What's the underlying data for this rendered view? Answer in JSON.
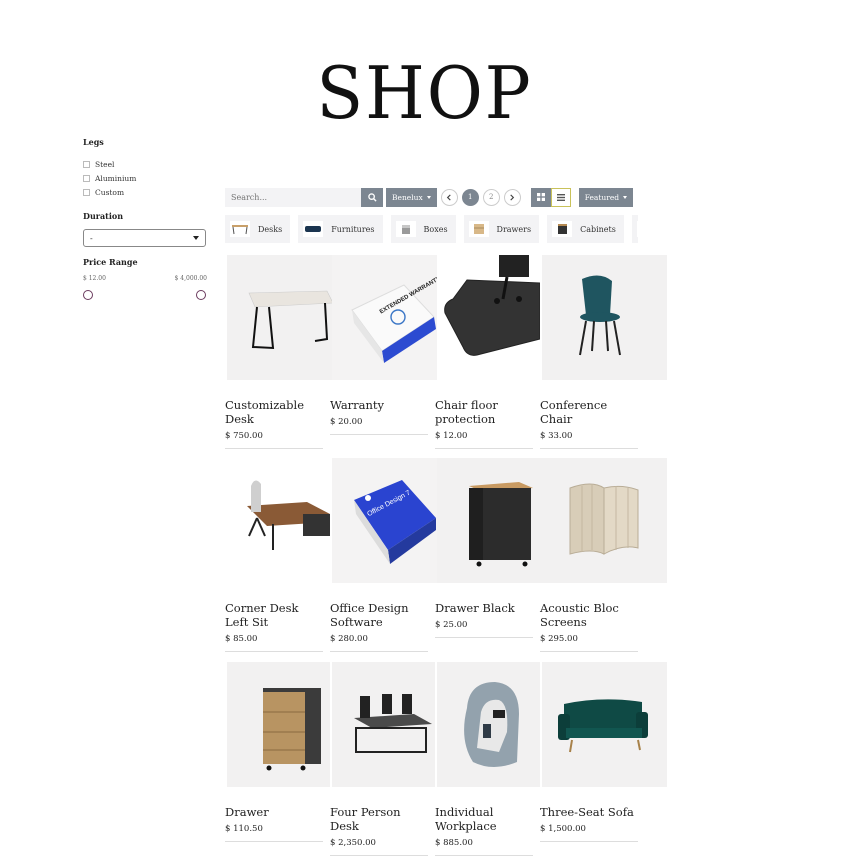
{
  "title": "SHOP",
  "filters": {
    "legs": {
      "title": "Legs",
      "options": [
        "Steel",
        "Aluminium",
        "Custom"
      ]
    },
    "duration": {
      "title": "Duration",
      "value": "-"
    },
    "price": {
      "title": "Price Range",
      "min": "$ 12.00",
      "max": "$ 4,000.00"
    }
  },
  "toolbar": {
    "search_placeholder": "Search...",
    "pricelist": "Benelux",
    "pages": [
      "1",
      "2"
    ],
    "sort": "Featured"
  },
  "categories": [
    "Desks",
    "Furnitures",
    "Boxes",
    "Drawers",
    "Cabinets"
  ],
  "products": [
    {
      "name": "Customizable Desk",
      "price": "$ 750.00"
    },
    {
      "name": "Warranty",
      "price": "$ 20.00"
    },
    {
      "name": "Chair floor protection",
      "price": "$ 12.00"
    },
    {
      "name": "Conference Chair",
      "price": "$ 33.00"
    },
    {
      "name": "Corner Desk Left Sit",
      "price": "$ 85.00"
    },
    {
      "name": "Office Design Software",
      "price": "$ 280.00"
    },
    {
      "name": "Drawer Black",
      "price": "$ 25.00"
    },
    {
      "name": "Acoustic Bloc Screens",
      "price": "$ 295.00"
    },
    {
      "name": "Drawer",
      "price": "$ 110.50"
    },
    {
      "name": "Four Person Desk",
      "price": "$ 2,350.00"
    },
    {
      "name": "Individual Workplace",
      "price": "$ 885.00"
    },
    {
      "name": "Three-Seat Sofa",
      "price": "$ 1,500.00"
    }
  ],
  "product_image_texts": {
    "warranty": "EXTENDED WARRANTY",
    "software": "Office Design 7"
  },
  "colors": {
    "accent": "#7c8691",
    "knob": "#6b3b5e"
  }
}
